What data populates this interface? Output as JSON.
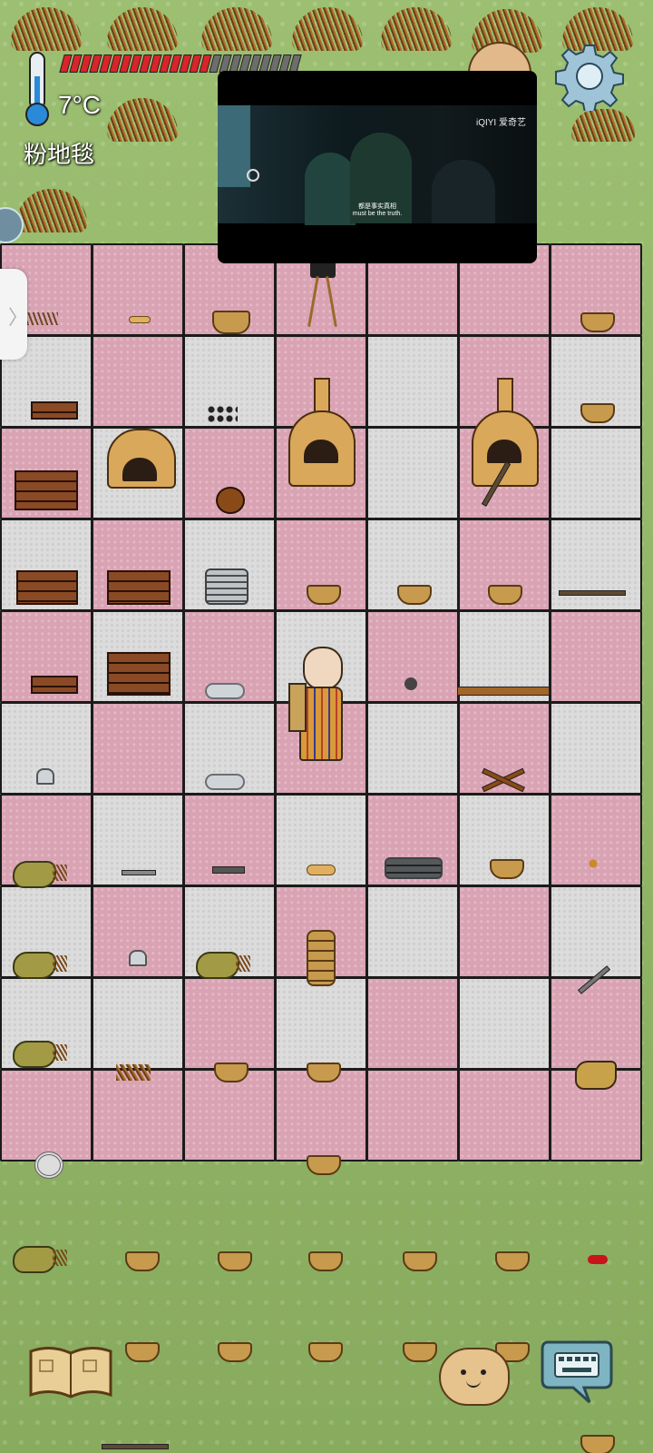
{
  "hud": {
    "temperature": "7°C",
    "tile_name": "粉地毯",
    "health_segments": 24,
    "health_filled": 15,
    "health_color": "#d8242a",
    "health_empty_color": "#6d6d6d"
  },
  "video_overlay": {
    "brand": "iQIYI 爱奇艺",
    "subtitle_cn": "都是事实真相",
    "subtitle_en": "must be the truth."
  },
  "icons": {
    "thermometer": "thermometer-icon",
    "settings": "gear-icon",
    "recipe_book": "book-icon",
    "emote": "potato-face-icon",
    "chat": "keyboard-icon",
    "side_tab": "chevron-right-icon"
  },
  "colors": {
    "pink_tile": "#d9a3b4",
    "white_tile": "#dcdcdc",
    "grass": "#8fb266"
  }
}
